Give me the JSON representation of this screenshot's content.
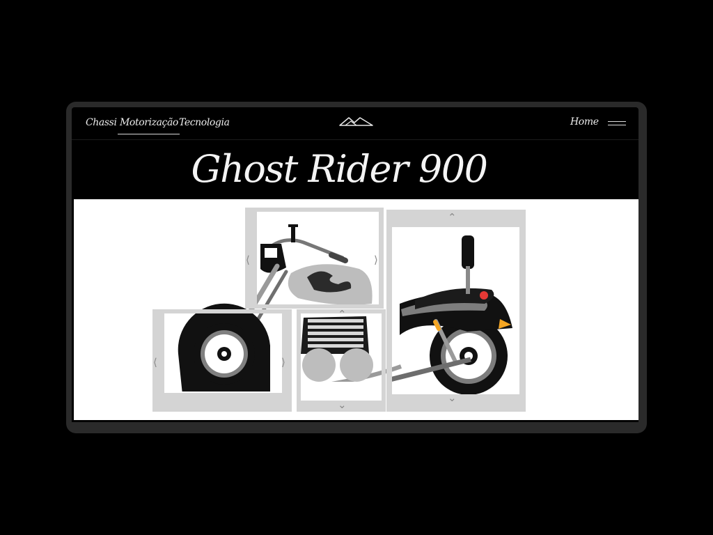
{
  "nav": {
    "items": [
      {
        "label": "Chassi"
      },
      {
        "label": "Motorização",
        "active": true
      },
      {
        "label": "Tecnologia"
      }
    ],
    "home_label": "Home"
  },
  "hero": {
    "title": "Ghost Rider 900"
  },
  "icons": {
    "logo": "mountain-logo-icon",
    "menu": "menu-lines-icon",
    "left": "chevron-left-icon",
    "right": "chevron-right-icon",
    "up": "chevron-up-icon",
    "down": "chevron-down-icon"
  },
  "colors": {
    "background": "#000000",
    "device_frame": "#2a2a2a",
    "tile_border": "#d4d4d4",
    "motorcycle_body": "#111111",
    "chrome": "#9a9a9a",
    "tail_light": "#e53935",
    "turn_signal": "#f5a623"
  }
}
